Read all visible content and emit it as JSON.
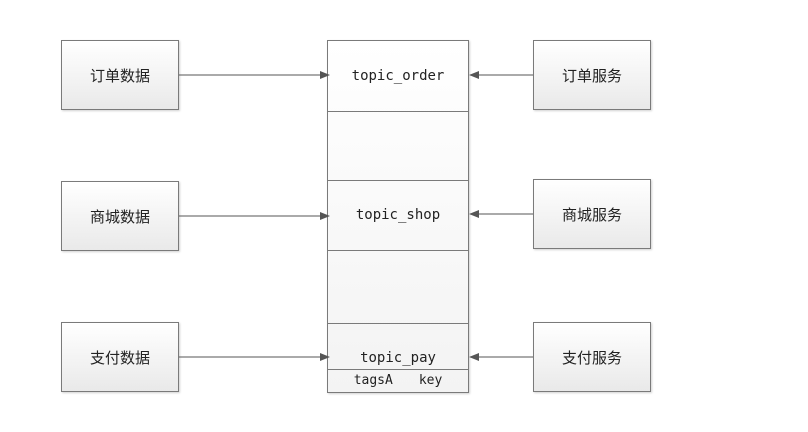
{
  "left_boxes": {
    "order_data": "订单数据",
    "shop_data": "商城数据",
    "pay_data": "支付数据"
  },
  "right_boxes": {
    "order_service": "订单服务",
    "shop_service": "商城服务",
    "pay_service": "支付服务"
  },
  "topics": {
    "order": "topic_order",
    "shop": "topic_shop",
    "pay": "topic_pay",
    "pay_tag": "tagsA",
    "pay_key": "key"
  },
  "colors": {
    "border": "#7a7a7a",
    "arrow": "#555555",
    "text": "#222222"
  }
}
